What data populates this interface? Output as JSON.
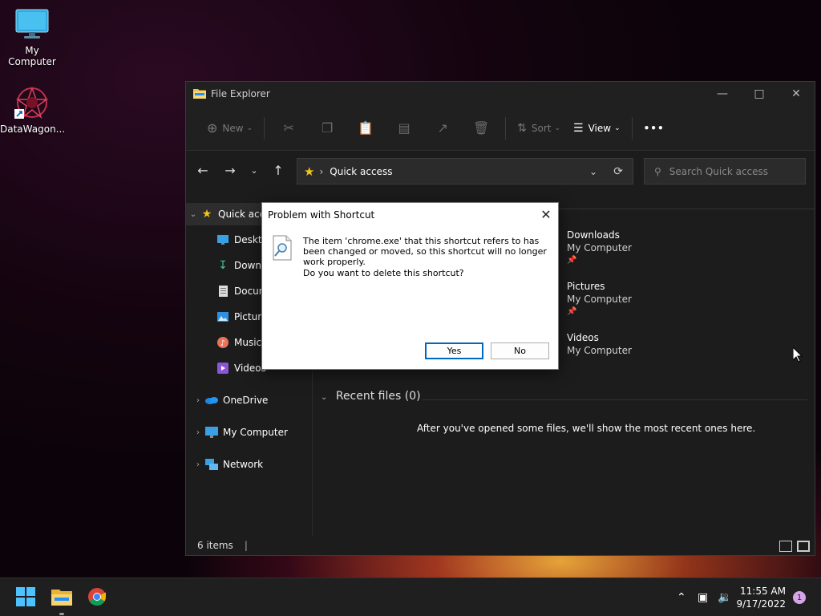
{
  "desktop": {
    "icons": [
      {
        "label": "My Computer"
      },
      {
        "label": "DataWagon..."
      }
    ]
  },
  "explorer": {
    "title": "File Explorer",
    "toolbar": {
      "new_label": "New",
      "sort_label": "Sort",
      "view_label": "View",
      "more_label": "•••"
    },
    "address": {
      "crumb": "Quick access"
    },
    "search": {
      "placeholder": "Search Quick access"
    },
    "nav": {
      "quick_access": "Quick access",
      "pinned": [
        "Desktop",
        "Downloads",
        "Documents",
        "Pictures",
        "Music",
        "Videos"
      ],
      "onedrive": "OneDrive",
      "my_computer": "My Computer",
      "network": "Network"
    },
    "quick_access_items": [
      {
        "name": "Downloads",
        "location": "My Computer",
        "pinned": true
      },
      {
        "name": "Pictures",
        "location": "My Computer",
        "pinned": true
      },
      {
        "name": "Videos",
        "location": "My Computer",
        "pinned": false
      }
    ],
    "recent": {
      "header": "Recent files (0)",
      "empty_message": "After you've opened some files, we'll show the most recent ones here."
    },
    "status": {
      "items": "6 items",
      "divider": "|"
    }
  },
  "dialog": {
    "title": "Problem with Shortcut",
    "message": "The item 'chrome.exe' that this shortcut refers to has been changed or moved, so this shortcut will no longer work properly.",
    "question": "Do you want to delete this shortcut?",
    "yes_label": "Yes",
    "no_label": "No"
  },
  "taskbar": {
    "time": "11:55 AM",
    "date": "9/17/2022",
    "notification_count": "1"
  },
  "colors": {
    "accent": "#0067c0",
    "explorer_bg": "#1c1c1c",
    "dialog_bg": "#ffffff",
    "taskbar_bg": "#1f1f1f"
  }
}
